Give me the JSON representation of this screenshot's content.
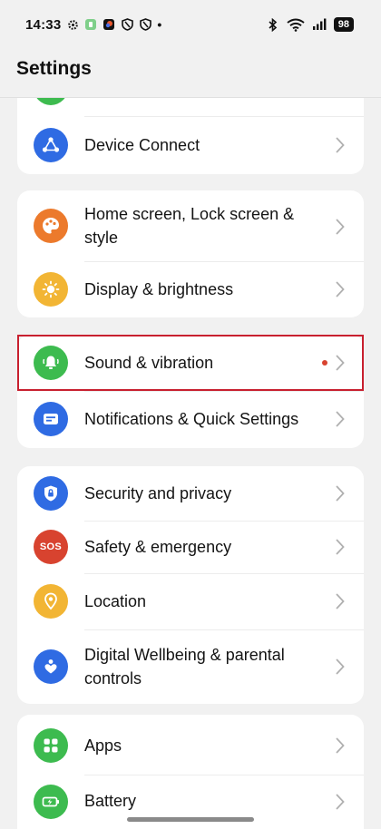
{
  "status_bar": {
    "time": "14:33",
    "battery": "98",
    "notification_dot": "•"
  },
  "header": {
    "title": "Settings"
  },
  "colors": {
    "green": "#3dbb4f",
    "blue": "#2f6be3",
    "orange": "#ec7a2c",
    "yellow": "#f2b534",
    "red": "#d8432f",
    "highlight": "#c8202f"
  },
  "groups": [
    {
      "items": [
        {
          "label": "Device Connect",
          "icon": "device-connect-icon"
        }
      ]
    },
    {
      "items": [
        {
          "label": "Home screen, Lock screen & style",
          "icon": "palette-icon"
        },
        {
          "label": "Display & brightness",
          "icon": "sun-icon"
        }
      ]
    },
    {
      "items": [
        {
          "label": "Sound & vibration",
          "icon": "bell-icon",
          "has_badge": true
        },
        {
          "label": "Notifications & Quick Settings",
          "icon": "notification-icon"
        }
      ]
    },
    {
      "items": [
        {
          "label": "Security and privacy",
          "icon": "shield-lock-icon"
        },
        {
          "label": "Safety & emergency",
          "icon_text": "SOS",
          "icon": "sos-icon"
        },
        {
          "label": "Location",
          "icon": "location-pin-icon"
        },
        {
          "label": "Digital Wellbeing & parental controls",
          "icon": "heart-person-icon"
        }
      ]
    },
    {
      "items": [
        {
          "label": "Apps",
          "icon": "apps-grid-icon"
        },
        {
          "label": "Battery",
          "icon": "battery-icon"
        }
      ]
    }
  ]
}
